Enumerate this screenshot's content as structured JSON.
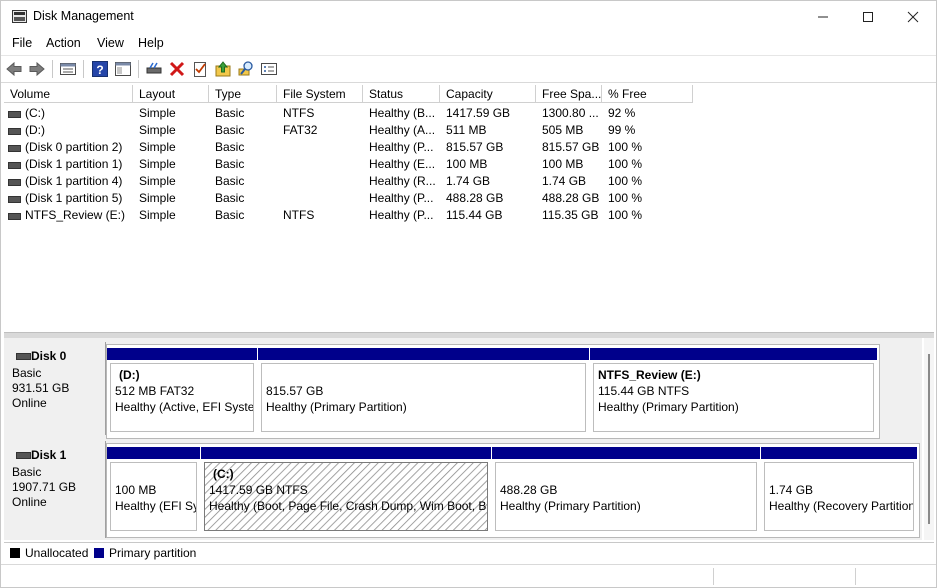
{
  "window": {
    "title": "Disk Management"
  },
  "menu": {
    "file": "File",
    "action": "Action",
    "view": "View",
    "help": "Help"
  },
  "columns": [
    "Volume",
    "Layout",
    "Type",
    "File System",
    "Status",
    "Capacity",
    "Free Spa...",
    "% Free"
  ],
  "volumes": [
    {
      "volume": "(C:)",
      "layout": "Simple",
      "type": "Basic",
      "fs": "NTFS",
      "status": "Healthy (B...",
      "capacity": "1417.59 GB",
      "free": "1300.80 ...",
      "pct": "92 %"
    },
    {
      "volume": "(D:)",
      "layout": "Simple",
      "type": "Basic",
      "fs": "FAT32",
      "status": "Healthy (A...",
      "capacity": "511 MB",
      "free": "505 MB",
      "pct": "99 %"
    },
    {
      "volume": "(Disk 0 partition 2)",
      "layout": "Simple",
      "type": "Basic",
      "fs": "",
      "status": "Healthy (P...",
      "capacity": "815.57 GB",
      "free": "815.57 GB",
      "pct": "100 %"
    },
    {
      "volume": "(Disk 1 partition 1)",
      "layout": "Simple",
      "type": "Basic",
      "fs": "",
      "status": "Healthy (E...",
      "capacity": "100 MB",
      "free": "100 MB",
      "pct": "100 %"
    },
    {
      "volume": "(Disk 1 partition 4)",
      "layout": "Simple",
      "type": "Basic",
      "fs": "",
      "status": "Healthy (R...",
      "capacity": "1.74 GB",
      "free": "1.74 GB",
      "pct": "100 %"
    },
    {
      "volume": "(Disk 1 partition 5)",
      "layout": "Simple",
      "type": "Basic",
      "fs": "",
      "status": "Healthy (P...",
      "capacity": "488.28 GB",
      "free": "488.28 GB",
      "pct": "100 %"
    },
    {
      "volume": "NTFS_Review  (E:)",
      "layout": "Simple",
      "type": "Basic",
      "fs": "NTFS",
      "status": "Healthy (P...",
      "capacity": "115.44 GB",
      "free": "115.35 GB",
      "pct": "100 %"
    }
  ],
  "disk0": {
    "name": "Disk 0",
    "type": "Basic",
    "size": "931.51 GB",
    "state": "Online",
    "partitions": [
      {
        "name": "(D:)",
        "size": "512 MB FAT32",
        "status": "Healthy (Active, EFI System"
      },
      {
        "name": "",
        "size": "815.57 GB",
        "status": "Healthy (Primary Partition)"
      },
      {
        "name": "NTFS_Review  (E:)",
        "size": "115.44 GB NTFS",
        "status": "Healthy (Primary Partition)"
      }
    ]
  },
  "disk1": {
    "name": "Disk 1",
    "type": "Basic",
    "size": "1907.71 GB",
    "state": "Online",
    "partitions": [
      {
        "name": "",
        "size": "100 MB",
        "status": "Healthy (EFI Sy"
      },
      {
        "name": "(C:)",
        "size": "1417.59 GB NTFS",
        "status": "Healthy (Boot, Page File, Crash Dump, Wim Boot, Ba"
      },
      {
        "name": "",
        "size": "488.28 GB",
        "status": "Healthy (Primary Partition)"
      },
      {
        "name": "",
        "size": "1.74 GB",
        "status": "Healthy (Recovery Partition"
      }
    ]
  },
  "legend": {
    "unallocated": "Unallocated",
    "primary": "Primary partition"
  },
  "colors": {
    "primary": "#00008b",
    "unallocated": "#000000"
  },
  "icons": [
    "back-arrow-icon",
    "forward-arrow-icon",
    "properties-icon",
    "help-icon",
    "show-pane-icon",
    "connect-icon",
    "delete-icon",
    "checklist-icon",
    "import-icon",
    "search-disk-icon",
    "console-icon"
  ]
}
